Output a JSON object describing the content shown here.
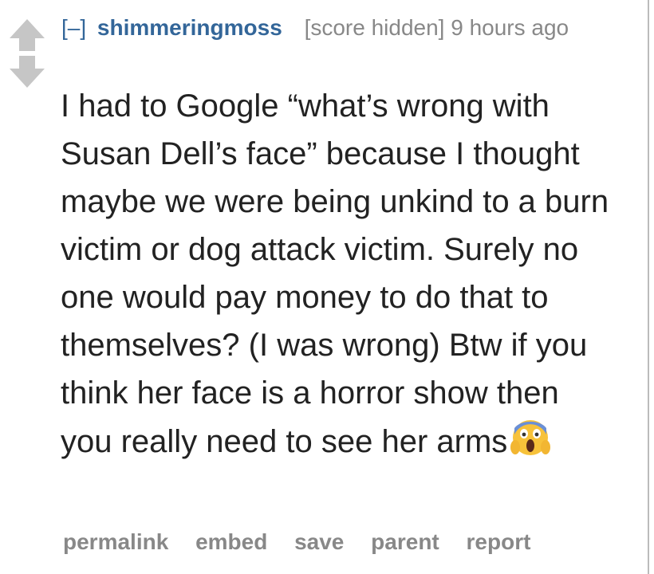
{
  "comment": {
    "expand_label": "[–]",
    "author": "shimmeringmoss",
    "score": "[score hidden]",
    "time": "9 hours ago",
    "body": "I had to Google “what’s wrong with Susan Dell’s face” because I thought maybe we were being unkind to a burn victim or dog attack victim. Surely no one would pay money to do that to themselves? (I was wrong) Btw if you think her face is a horror show then you really need to see her arms",
    "body_emoji": "face-screaming-in-fear-icon",
    "actions": {
      "permalink": "permalink",
      "embed": "embed",
      "save": "save",
      "parent": "parent",
      "report": "report"
    }
  },
  "vote": {
    "up_icon": "upvote-arrow-icon",
    "down_icon": "downvote-arrow-icon"
  },
  "colors": {
    "author": "#336699",
    "meta": "#888888",
    "text": "#222222",
    "arrow": "#c6c6c6"
  }
}
